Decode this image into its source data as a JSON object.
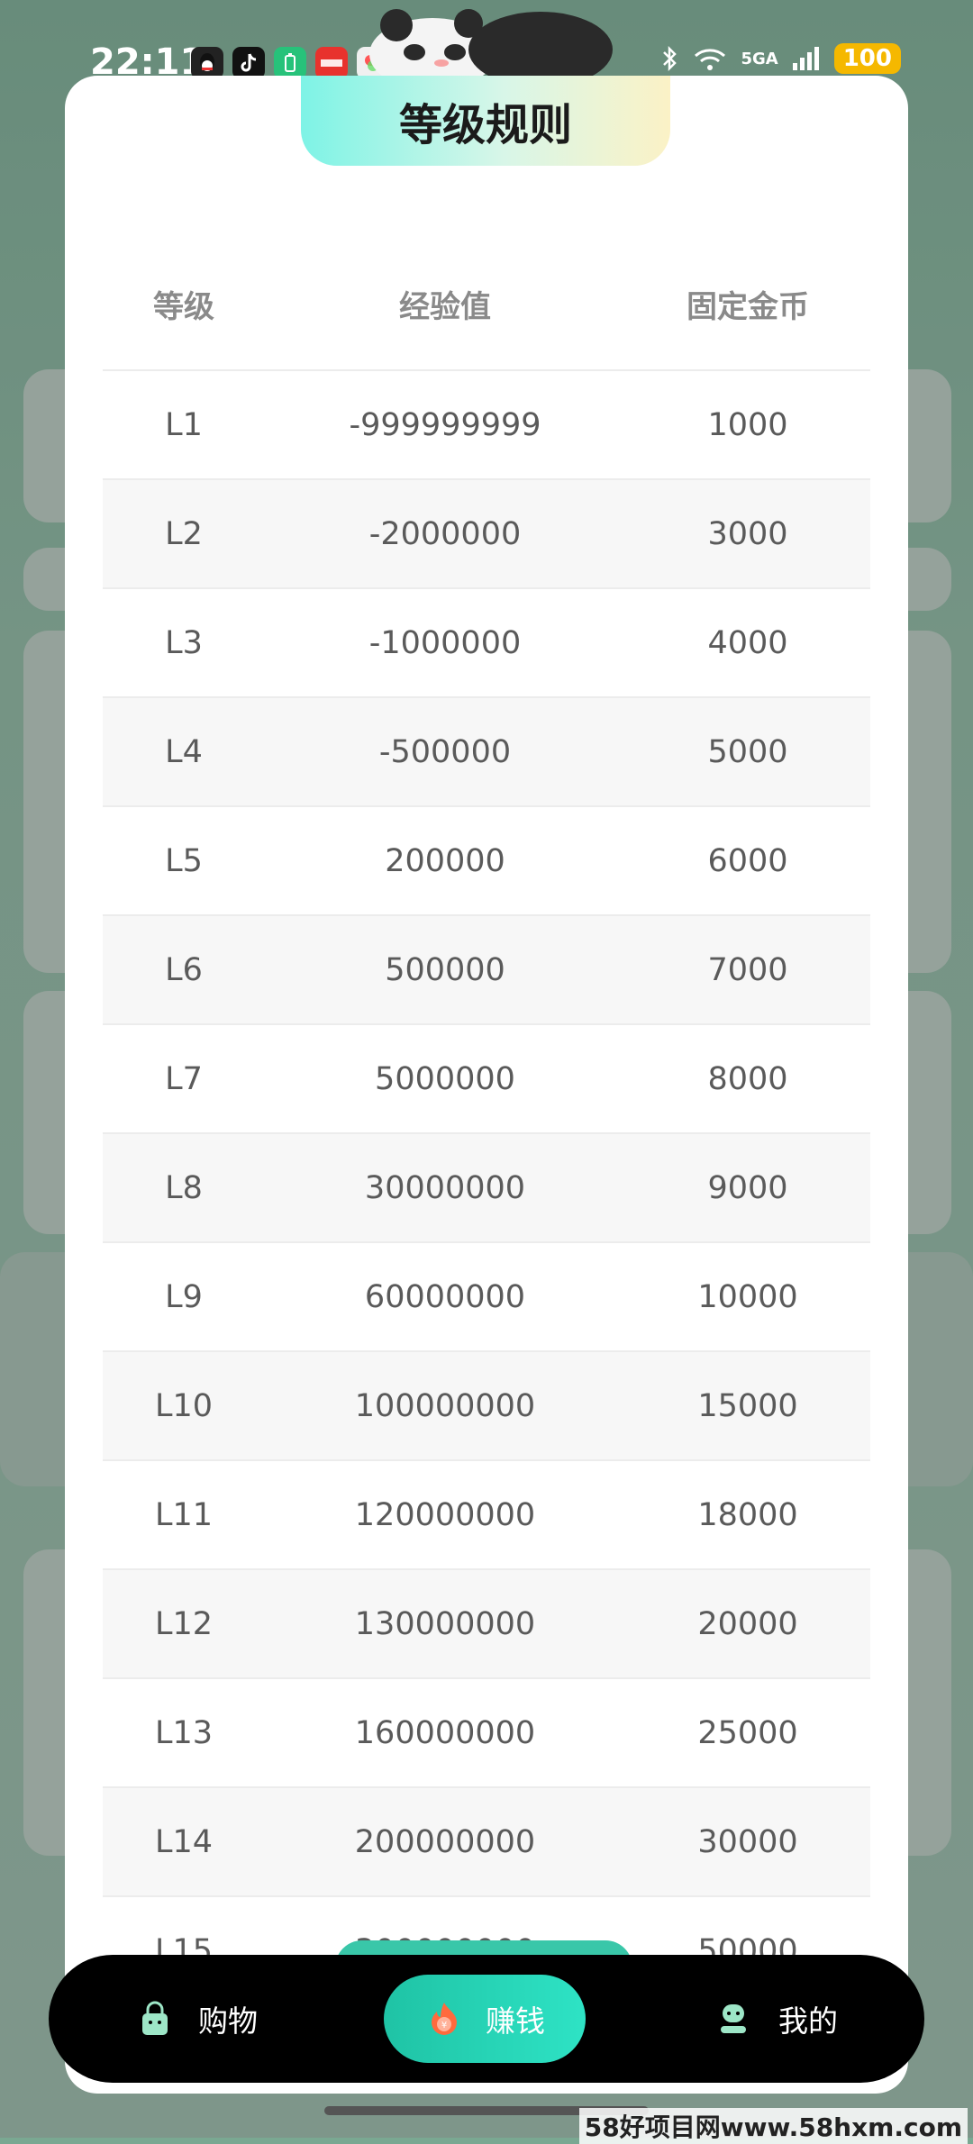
{
  "status_bar": {
    "time": "22:11",
    "network": "5GA",
    "battery": "100"
  },
  "modal": {
    "title": "等级规则",
    "columns": [
      "等级",
      "经验值",
      "固定金币"
    ],
    "rows": [
      [
        "L1",
        "-999999999",
        "1000"
      ],
      [
        "L2",
        "-2000000",
        "3000"
      ],
      [
        "L3",
        "-1000000",
        "4000"
      ],
      [
        "L4",
        "-500000",
        "5000"
      ],
      [
        "L5",
        "200000",
        "6000"
      ],
      [
        "L6",
        "500000",
        "7000"
      ],
      [
        "L7",
        "5000000",
        "8000"
      ],
      [
        "L8",
        "30000000",
        "9000"
      ],
      [
        "L9",
        "60000000",
        "10000"
      ],
      [
        "L10",
        "100000000",
        "15000"
      ],
      [
        "L11",
        "120000000",
        "18000"
      ],
      [
        "L12",
        "130000000",
        "20000"
      ],
      [
        "L13",
        "160000000",
        "25000"
      ],
      [
        "L14",
        "200000000",
        "30000"
      ],
      [
        "L15",
        "300000000",
        "50000"
      ]
    ]
  },
  "bottom_nav": {
    "shop_label": "购物",
    "earn_label": "赚钱",
    "mine_label": "我的"
  },
  "watermark": "58好项目网www.58hxm.com",
  "colors": {
    "accent": "#1fc3a5",
    "nav_bg": "#000000",
    "battery": "#f5b800"
  }
}
